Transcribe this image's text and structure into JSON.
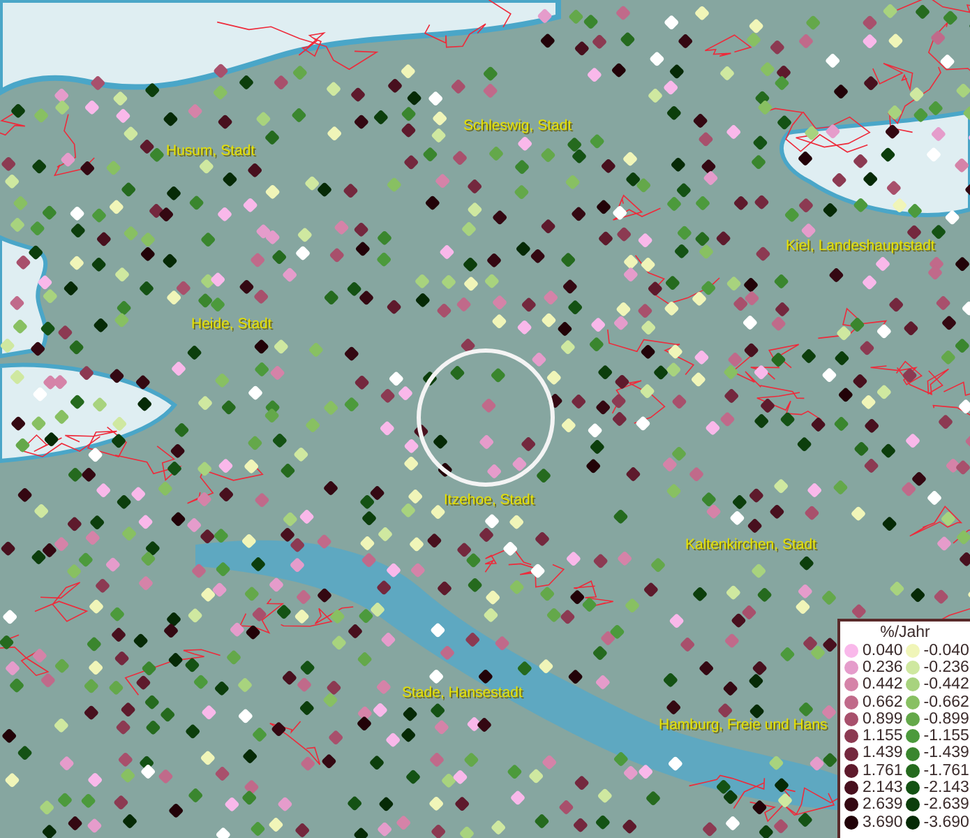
{
  "places": [
    {
      "name": "Husum, Stadt"
    },
    {
      "name": "Schleswig, Stadt"
    },
    {
      "name": "Kiel, Landeshauptstadt"
    },
    {
      "name": "Heide, Stadt"
    },
    {
      "name": "Itzehoe, Stadt"
    },
    {
      "name": "Kaltenkirchen, Stadt"
    },
    {
      "name": "Stade, Hansestadt"
    },
    {
      "name": "Hamburg, Freie und Hans"
    }
  ],
  "legend": {
    "title": "%/Jahr",
    "items": [
      {
        "value": "0.040",
        "color": "#f9b8ea"
      },
      {
        "value": "-0.040",
        "color": "#f0f5b8"
      },
      {
        "value": "0.236",
        "color": "#e59ccb"
      },
      {
        "value": "-0.236",
        "color": "#cfe8a0"
      },
      {
        "value": "0.442",
        "color": "#d583a8"
      },
      {
        "value": "-0.442",
        "color": "#a8d37e"
      },
      {
        "value": "0.662",
        "color": "#c06a8a"
      },
      {
        "value": "-0.662",
        "color": "#88c062"
      },
      {
        "value": "0.899",
        "color": "#a8506c"
      },
      {
        "value": "-0.899",
        "color": "#64a84a"
      },
      {
        "value": "1.155",
        "color": "#8c3a52"
      },
      {
        "value": "-1.155",
        "color": "#4c9a3c"
      },
      {
        "value": "1.439",
        "color": "#74283e"
      },
      {
        "value": "-1.439",
        "color": "#3a862e"
      },
      {
        "value": "1.761",
        "color": "#5e1a2c"
      },
      {
        "value": "-1.761",
        "color": "#256a1e"
      },
      {
        "value": "2.143",
        "color": "#48101e"
      },
      {
        "value": "-2.143",
        "color": "#145214"
      },
      {
        "value": "2.639",
        "color": "#340812"
      },
      {
        "value": "-2.639",
        "color": "#0c3e0c"
      },
      {
        "value": "3.690",
        "color": "#220208"
      },
      {
        "value": "-3.690",
        "color": "#062a06"
      }
    ]
  }
}
